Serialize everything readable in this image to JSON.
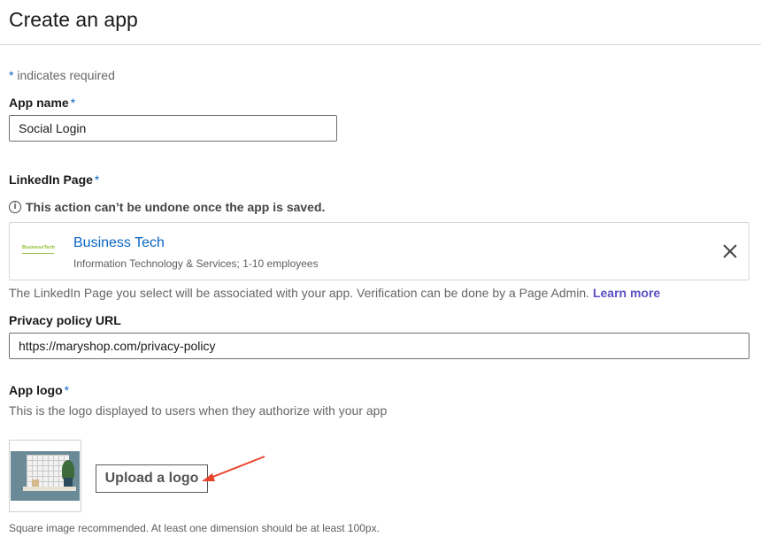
{
  "header": {
    "title": "Create an app"
  },
  "required_note": {
    "star": "*",
    "text": " indicates required"
  },
  "app_name": {
    "label": "App name",
    "required": "*",
    "value": "Social Login"
  },
  "linkedin_page": {
    "label": "LinkedIn Page",
    "required": "*",
    "warning_icon": "info-icon",
    "warning": "This action can’t be undone once the app is saved.",
    "selected_page": {
      "logo_text": "BusinessTech",
      "name": "Business Tech",
      "details": "Information Technology & Services; 1-10 employees"
    },
    "helper_text": "The LinkedIn Page you select will be associated with your app. Verification can be done by a Page Admin. ",
    "learn_more": "Learn more"
  },
  "privacy_policy": {
    "label": "Privacy policy URL",
    "value": "https://maryshop.com/privacy-policy"
  },
  "app_logo": {
    "label": "App logo",
    "required": "*",
    "description": "This is the logo displayed to users when they authorize with your app",
    "upload_button": "Upload a logo",
    "note": "Square image recommended. At least one dimension should be at least 100px."
  },
  "colors": {
    "accent_blue": "#0a66c2",
    "link_purple": "#5b4fc2",
    "annotation_arrow": "#e8442c"
  }
}
